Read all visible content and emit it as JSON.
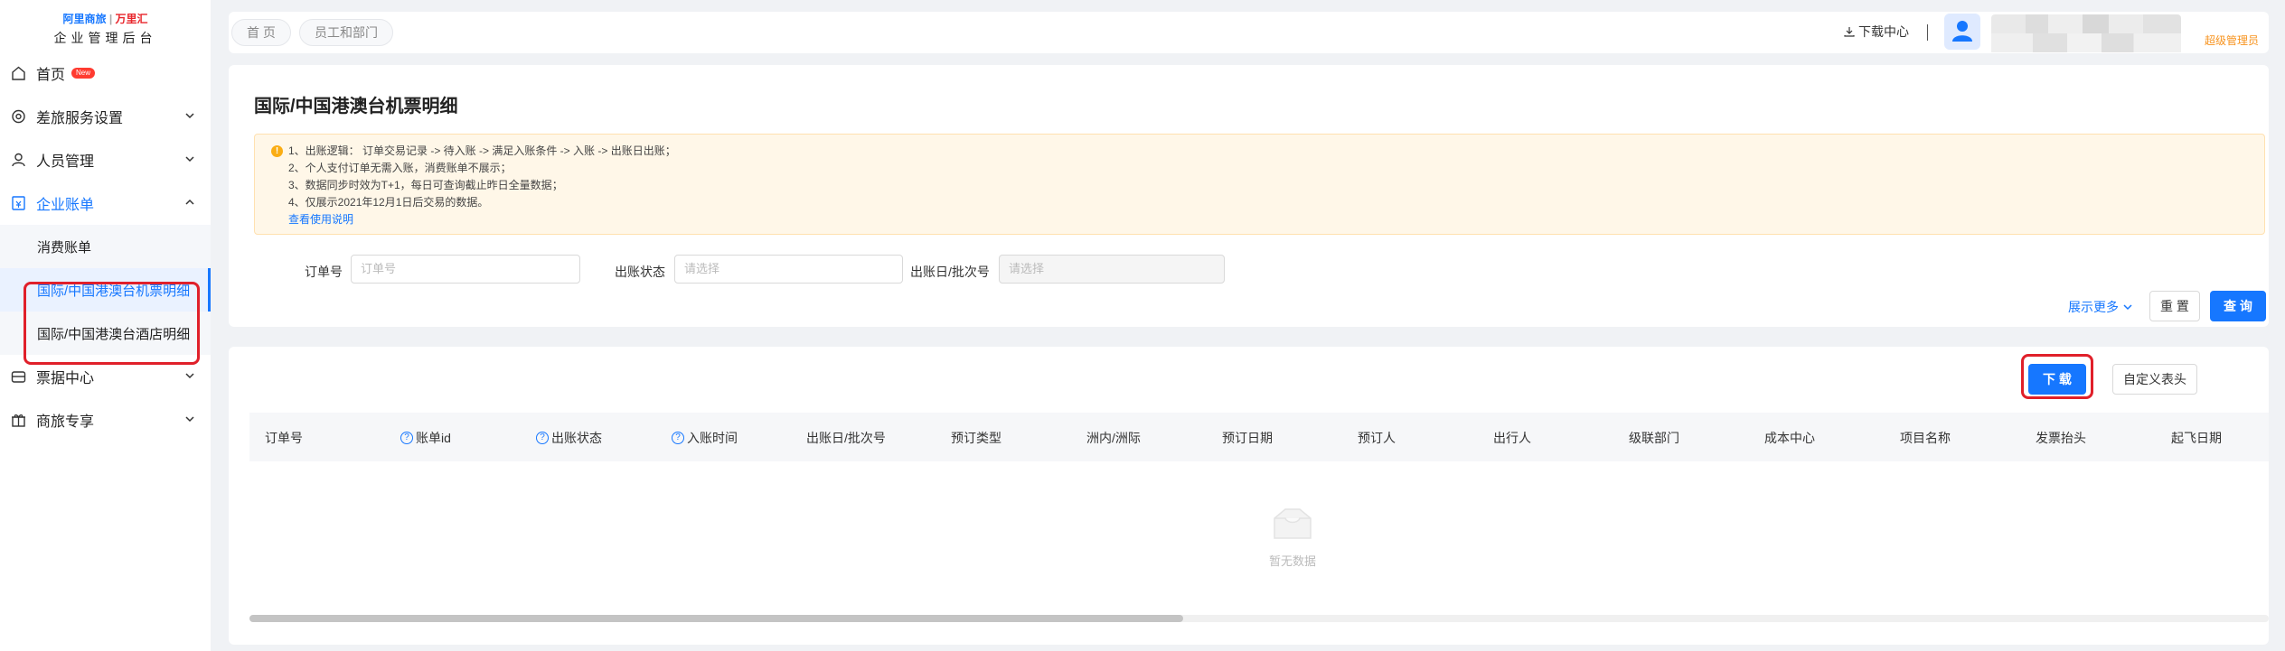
{
  "logo": {
    "brand_left": "阿里商旅",
    "brand_right": "万里汇",
    "subtitle": "企业管理后台"
  },
  "sidebar": {
    "home": {
      "label": "首页",
      "badge": "New"
    },
    "travel_settings": {
      "label": "差旅服务设置"
    },
    "people": {
      "label": "人员管理"
    },
    "billing": {
      "label": "企业账单"
    },
    "billing_items": [
      {
        "label": "消费账单"
      },
      {
        "label": "国际/中国港澳台机票明细"
      },
      {
        "label": "国际/中国港澳台酒店明细"
      }
    ],
    "invoice": {
      "label": "票据中心"
    },
    "deals": {
      "label": "商旅专享"
    }
  },
  "topbar": {
    "breadcrumbs": [
      "首 页",
      "员工和部门"
    ],
    "download_center": "下载中心",
    "role": "超级管理员"
  },
  "page": {
    "title": "国际/中国港澳台机票明细",
    "notice": {
      "lines": [
        "1、出账逻辑： 订单交易记录 -> 待入账 -> 满足入账条件 -> 入账 -> 出账日出账；",
        "2、个人支付订单无需入账，消费账单不展示；",
        "3、数据同步时效为T+1，每日可查询截止昨日全量数据；",
        "4、仅展示2021年12月1日后交易的数据。"
      ],
      "link": "查看使用说明"
    },
    "filters": {
      "order_no": {
        "label": "订单号",
        "placeholder": "订单号"
      },
      "status": {
        "label": "出账状态",
        "placeholder": "请选择"
      },
      "batch": {
        "label": "出账日/批次号",
        "placeholder": "请选择"
      }
    },
    "more": "展示更多",
    "reset": "重 置",
    "query": "查 询"
  },
  "table": {
    "custom_header": "自定义表头",
    "download": "下 载",
    "columns": [
      "订单号",
      "账单id",
      "出账状态",
      "入账时间",
      "出账日/批次号",
      "预订类型",
      "洲内/洲际",
      "预订日期",
      "预订人",
      "出行人",
      "级联部门",
      "成本中心",
      "项目名称",
      "发票抬头",
      "起飞日期"
    ],
    "empty_text": "暂无数据"
  }
}
